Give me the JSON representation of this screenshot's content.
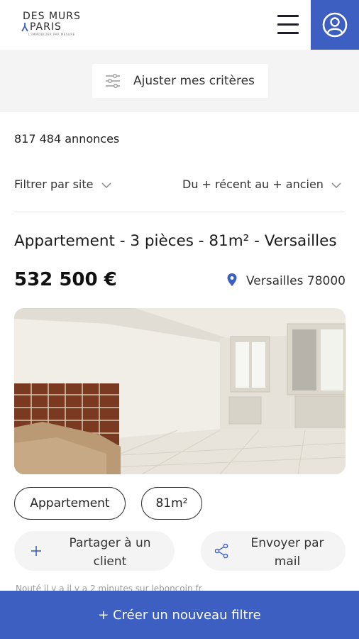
{
  "header": {
    "logo_line1": "DES MURS",
    "logo_line2": "PARIS",
    "logo_tagline": "L'IMMOBILIER PAR MESURE",
    "menu_icon": "hamburger-icon",
    "account_icon": "user-circle-icon"
  },
  "criteria": {
    "label": "Ajuster mes critères",
    "icon": "sliders-icon"
  },
  "results": {
    "count_text": "817 484 annonces"
  },
  "filters": {
    "site_label": "Filtrer par site",
    "sort_label": "Du + récent au + ancien"
  },
  "listing": {
    "title": "Appartement - 3 pièces - 81m² - Versailles",
    "price": "532 500 €",
    "location": "Versailles 78000",
    "tags": [
      "Appartement",
      "81m²"
    ],
    "share_label": "Partager à un client",
    "mail_label": "Envoyer par mail",
    "footnote": "Nouté il y a il y a 2 minutes sur leboncoin.fr"
  },
  "footer": {
    "create_filter_label": "+ Créer un nouveau filtre"
  },
  "colors": {
    "accent": "#3d5fc1",
    "band": "#f4f4f4"
  }
}
